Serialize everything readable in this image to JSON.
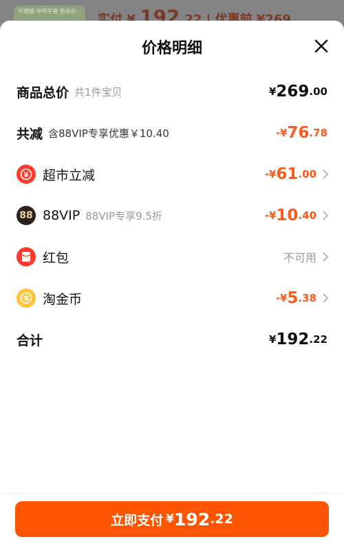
{
  "backdrop": {
    "thumb_label": "不夜城·中华午夜 秒杀价",
    "paid_label": "实付",
    "currency": "¥",
    "paid_int": "192",
    "paid_dec": ".22",
    "separator": "|",
    "before_label": "优惠前",
    "before_value": "¥269"
  },
  "sheet": {
    "title": "价格明细",
    "close_icon": "close-icon"
  },
  "rows": {
    "total": {
      "label": "商品总价",
      "sub": "共1件宝贝",
      "currency": "¥",
      "int": "269",
      "dec": ".00"
    },
    "reduce": {
      "label": "共减",
      "sub": "含88VIP专享优惠￥10.40",
      "prefix": "-¥",
      "int": "76",
      "dec": ".78"
    },
    "market": {
      "icon": "supermarket-discount-icon",
      "label": "超市立减",
      "prefix": "-¥",
      "int": "61",
      "dec": ".00"
    },
    "vip": {
      "icon": "88vip-badge-icon",
      "icon_text": "88",
      "label": "88VIP",
      "sub": "88VIP专享9.5折",
      "prefix": "-¥",
      "int": "10",
      "dec": ".40"
    },
    "redpacket": {
      "icon": "red-packet-icon",
      "label": "红包",
      "status": "不可用"
    },
    "coin": {
      "icon": "taojin-coin-icon",
      "label": "淘金币",
      "prefix": "-¥",
      "int": "5",
      "dec": ".38"
    },
    "sum": {
      "label": "合计",
      "currency": "¥",
      "int": "192",
      "dec": ".22"
    }
  },
  "footer": {
    "pay_label": "立即支付",
    "currency": "¥",
    "int": "192",
    "dec": ".22"
  },
  "colors": {
    "accent": "#ff5500",
    "discount": "#ff5a1a",
    "muted": "#999999"
  }
}
